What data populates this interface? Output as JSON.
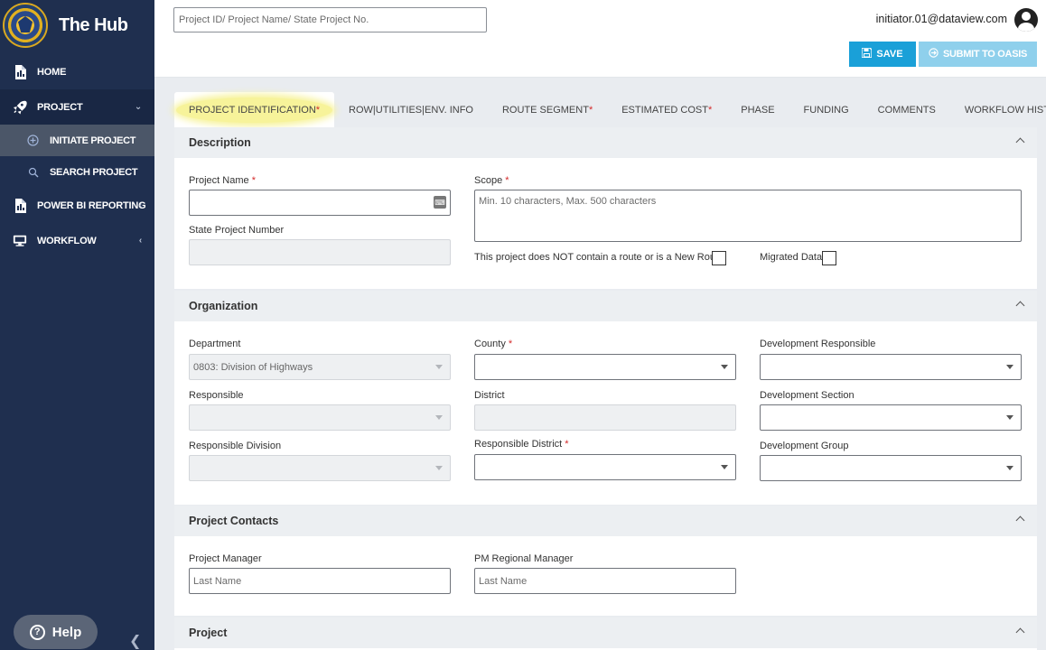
{
  "app": {
    "title": "The Hub"
  },
  "sidebar": {
    "items": [
      {
        "label": "HOME",
        "icon": "file-icon"
      },
      {
        "label": "PROJECT",
        "icon": "rocket-icon",
        "expanded": true
      },
      {
        "label": "POWER BI REPORTING",
        "icon": "report-icon"
      },
      {
        "label": "WORKFLOW",
        "icon": "monitor-icon"
      }
    ],
    "subitems": [
      {
        "label": "INITIATE PROJECT",
        "icon": "plus-circle-icon",
        "active": true
      },
      {
        "label": "SEARCH PROJECT",
        "icon": "search-icon"
      }
    ],
    "help_label": "Help"
  },
  "header": {
    "search_placeholder": "Project ID/ Project Name/ State Project No.",
    "user_email": "initiator.01@dataview.com",
    "save_label": "SAVE",
    "submit_label": "SUBMIT TO OASIS"
  },
  "tabs": [
    {
      "label": "PROJECT IDENTIFICATION",
      "required": true,
      "active": true
    },
    {
      "label": "ROW|UTILITIES|ENV. INFO",
      "required": false
    },
    {
      "label": "ROUTE SEGMENT",
      "required": true
    },
    {
      "label": "ESTIMATED COST",
      "required": true
    },
    {
      "label": "PHASE",
      "required": false
    },
    {
      "label": "FUNDING",
      "required": false
    },
    {
      "label": "COMMENTS",
      "required": false
    },
    {
      "label": "WORKFLOW HISTORY",
      "required": false
    }
  ],
  "description": {
    "title": "Description",
    "project_name_label": "Project Name",
    "project_name_value": "",
    "state_project_number_label": "State Project Number",
    "state_project_number_value": "",
    "scope_label": "Scope",
    "scope_placeholder": "Min. 10 characters, Max. 500 characters",
    "no_route_label": "This project does NOT contain a route or is a New Route",
    "migrated_label": "Migrated Data"
  },
  "organization": {
    "title": "Organization",
    "department_label": "Department",
    "department_value": "0803: Division of Highways",
    "county_label": "County",
    "county_value": "",
    "dev_responsible_label": "Development Responsible",
    "dev_responsible_value": "",
    "responsible_label": "Responsible",
    "responsible_value": "",
    "district_label": "District",
    "district_value": "",
    "dev_section_label": "Development Section",
    "dev_section_value": "",
    "responsible_division_label": "Responsible Division",
    "responsible_division_value": "",
    "responsible_district_label": "Responsible District",
    "responsible_district_value": "",
    "dev_group_label": "Development Group",
    "dev_group_value": ""
  },
  "contacts": {
    "title": "Project Contacts",
    "pm_label": "Project Manager",
    "pm_placeholder": "Last Name",
    "pm_regional_label": "PM Regional Manager",
    "pm_regional_placeholder": "Last Name"
  },
  "project_section": {
    "title": "Project"
  }
}
